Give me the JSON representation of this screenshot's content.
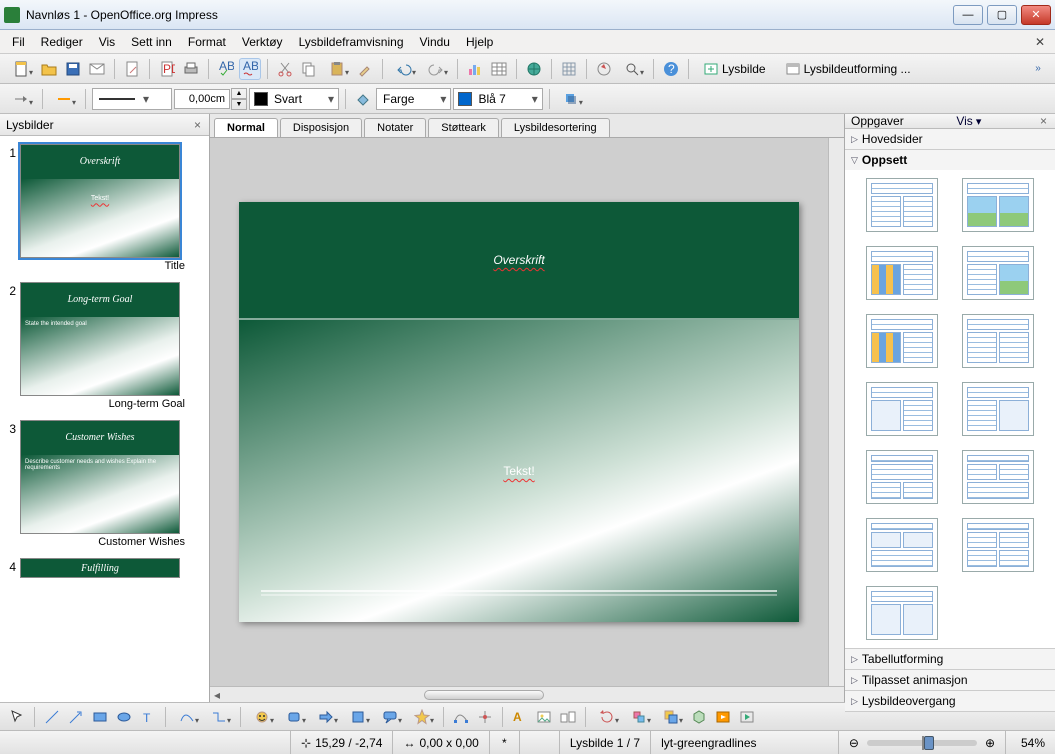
{
  "window": {
    "title": "Navnløs 1 - OpenOffice.org Impress"
  },
  "menu": {
    "file": "Fil",
    "edit": "Rediger",
    "view": "Vis",
    "insert": "Sett inn",
    "format": "Format",
    "tools": "Verktøy",
    "slideshow": "Lysbildeframvisning",
    "window": "Vindu",
    "help": "Hjelp"
  },
  "toolbar2": {
    "lineWidth": "0,00cm",
    "lineColorLabel": "Svart",
    "fillModeLabel": "Farge",
    "fillColorLabel": "Blå 7"
  },
  "toolbarButtons": {
    "slideBtn": "Lysbilde",
    "slideDesignBtn": "Lysbildeutforming ..."
  },
  "panels": {
    "slidesTitle": "Lysbilder",
    "tasksTitle": "Oppgaver",
    "tasksViewLabel": "Vis"
  },
  "viewTabs": {
    "normal": "Normal",
    "outline": "Disposisjon",
    "notes": "Notater",
    "handout": "Støtteark",
    "sorter": "Lysbildesortering"
  },
  "slides": [
    {
      "num": "1",
      "title": "Overskrift",
      "body": "Tekst!",
      "label": "Title"
    },
    {
      "num": "2",
      "title": "Long-term Goal",
      "body": "State the intended goal",
      "label": "Long-term Goal"
    },
    {
      "num": "3",
      "title": "Customer Wishes",
      "body": "Describe customer needs and wishes\nExplain the requirements",
      "label": "Customer Wishes"
    },
    {
      "num": "4",
      "title": "Fulfilling",
      "body": "",
      "label": ""
    }
  ],
  "currentSlide": {
    "title": "Overskrift",
    "body": "Tekst!"
  },
  "taskSections": {
    "master": "Hovedsider",
    "layout": "Oppsett",
    "table": "Tabellutforming",
    "anim": "Tilpasset animasjon",
    "trans": "Lysbildeovergang"
  },
  "status": {
    "cursor": "15,29 / -2,74",
    "size": "0,00 x 0,00",
    "modified": "*",
    "slideOf": "Lysbilde 1 / 7",
    "template": "lyt-greengradlines",
    "zoom": "54%"
  },
  "colors": {
    "slideGreen": "#0d5938",
    "accentBlue": "#3a86d6"
  }
}
